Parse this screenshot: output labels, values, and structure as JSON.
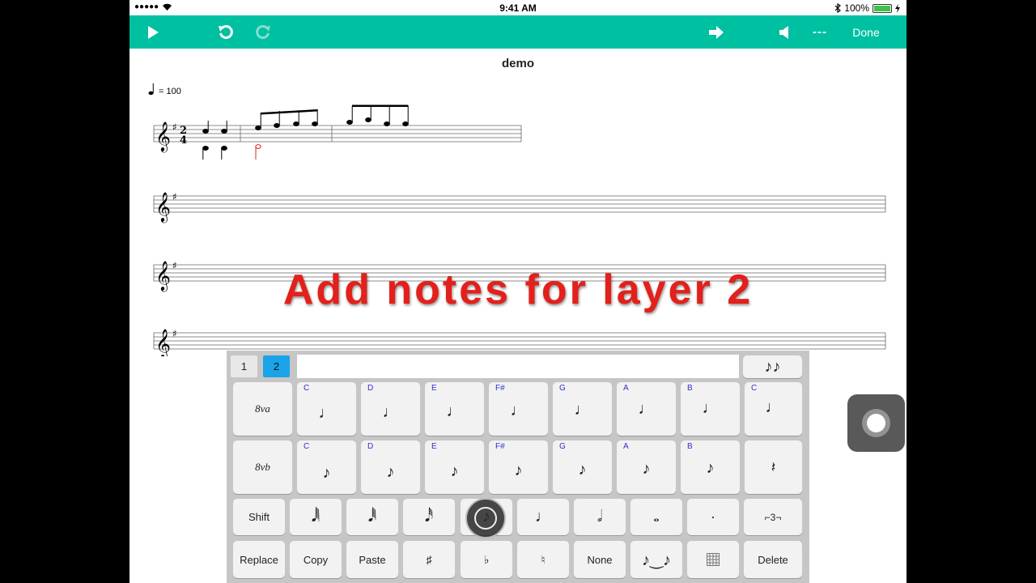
{
  "status": {
    "time": "9:41 AM",
    "battery": "100%"
  },
  "toolbar": {
    "tempo_dashes": "---",
    "done_label": "Done"
  },
  "score": {
    "title": "demo",
    "tempo": "= 100",
    "time_sig_top": "2",
    "time_sig_bottom": "4"
  },
  "overlay": {
    "text": "Add notes for layer 2"
  },
  "keyboard": {
    "layers": [
      "1",
      "2"
    ],
    "active_layer": "2",
    "octave_up": "8va",
    "octave_down": "8vb",
    "note_names_row1": [
      "C",
      "D",
      "E",
      "F#",
      "G",
      "A",
      "B",
      "C"
    ],
    "note_names_row2": [
      "C",
      "D",
      "E",
      "F#",
      "G",
      "A",
      "B"
    ],
    "shift_label": "Shift",
    "replace_label": "Replace",
    "copy_label": "Copy",
    "paste_label": "Paste",
    "none_label": "None",
    "delete_label": "Delete",
    "sharp": "♯",
    "flat": "♭",
    "natural": "♮",
    "dot": "·",
    "triplet": "⌐3¬"
  },
  "colors": {
    "accent": "#00c0a2",
    "overlay_red": "#e3201b",
    "layer_active": "#1aa3e8",
    "note_name": "#2f2fcf",
    "layer2_note": "#e02020"
  }
}
